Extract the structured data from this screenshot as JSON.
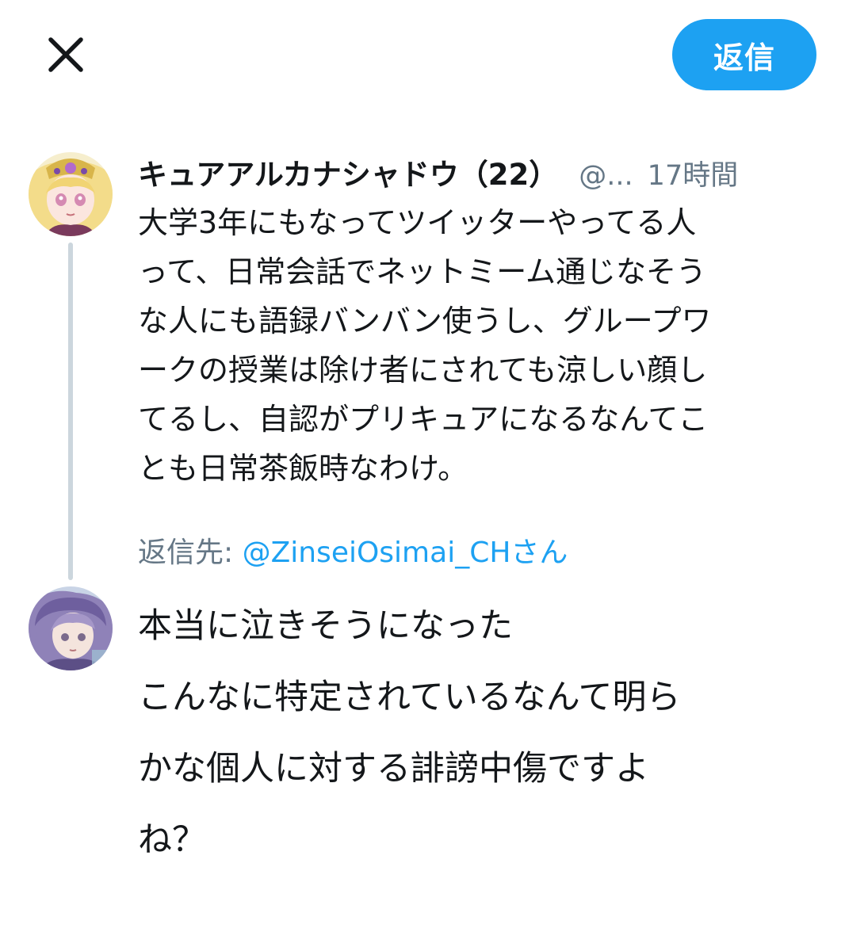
{
  "header": {
    "close_icon": "close-icon",
    "reply_button_label": "返信",
    "accent_color": "#1da1f2"
  },
  "tweet": {
    "display_name": "キュアアルカナシャドウ（22）",
    "handle": "@...",
    "time": "17時間",
    "body_lines": [
      "大学3年にもなってツイッターやってる人",
      "って、日常会話でネットミーム通じなそう",
      "な人にも語録バンバン使うし、グループワ",
      "ークの授業は除け者にされても涼しい顔し",
      "てるし、自認がプリキュアになるなんてこ",
      "とも日常茶飯時なわけ。"
    ]
  },
  "reply": {
    "reply_to_prefix": "返信先: ",
    "reply_to_mention": "@ZinseiOsimai_CHさん",
    "body_lines": [
      "本当に泣きそうになった",
      "こんなに特定されているなんて明ら",
      "かな個人に対する誹謗中傷ですよ",
      "ね？"
    ]
  }
}
